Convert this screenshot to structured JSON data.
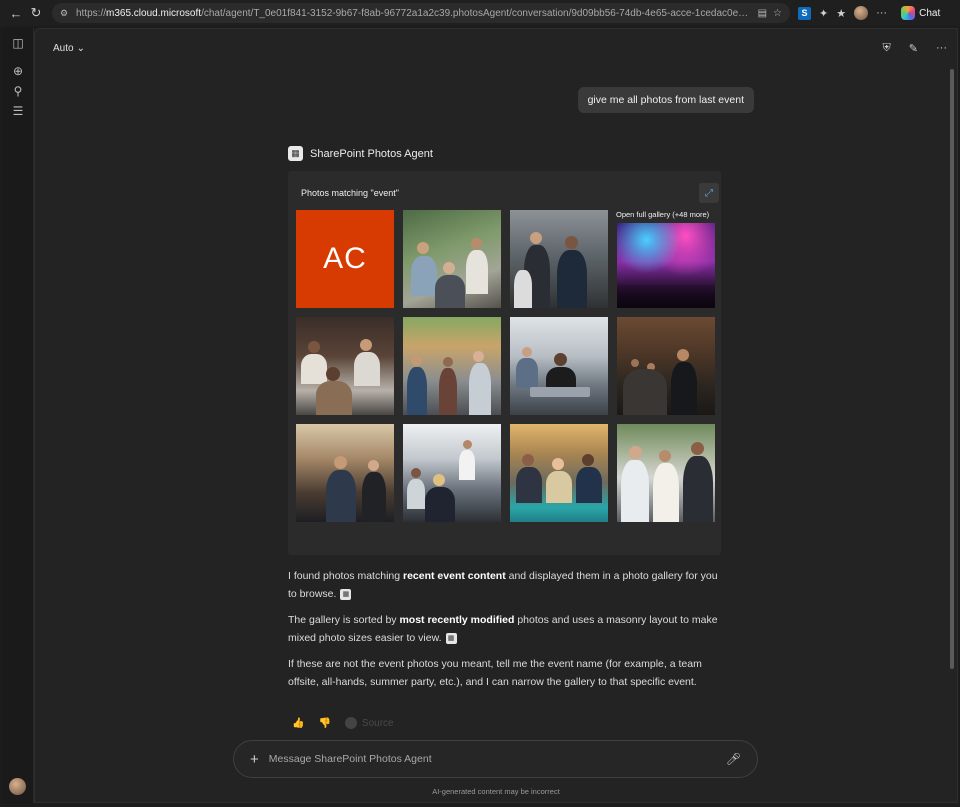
{
  "browser": {
    "url_prefix": "https://",
    "url_host": "m365.cloud.microsoft",
    "url_path": "/chat/agent/T_0e01f841-3152-9b67-f8ab-96772a1a2c39.photosAgent/conversation/9d09bb56-74db-4e65-acce-1cedac0ed557...",
    "chat_label": "Chat"
  },
  "header": {
    "mode_label": "Auto"
  },
  "conversation": {
    "user_message": "give me all photos from last event",
    "agent_name": "SharePoint Photos Agent",
    "gallery": {
      "title": "Photos matching \"event\"",
      "overlay_label": "Open full gallery (+48 more)",
      "ac_tile_text": "AC"
    },
    "response": {
      "p1_a": "I found photos matching ",
      "p1_b": "recent event content",
      "p1_c": " and displayed them in a photo gallery for you to browse.",
      "p2_a": "The gallery is sorted by ",
      "p2_b": "most recently modified",
      "p2_c": " photos and uses a masonry layout to make mixed photo sizes easier to view.",
      "p3": "If these are not the event photos you meant, tell me the event name (for example, a team offsite, all-hands, summer party, etc.), and I can narrow the gallery to that specific event."
    },
    "feedback": {
      "source_label": "Source"
    }
  },
  "composer": {
    "placeholder": "Message SharePoint Photos Agent"
  },
  "footer": {
    "disclaimer": "AI-generated content may be incorrect"
  },
  "colors": {
    "ac_tile": "#d83b01",
    "accent_blue": "#5aa9e6"
  }
}
